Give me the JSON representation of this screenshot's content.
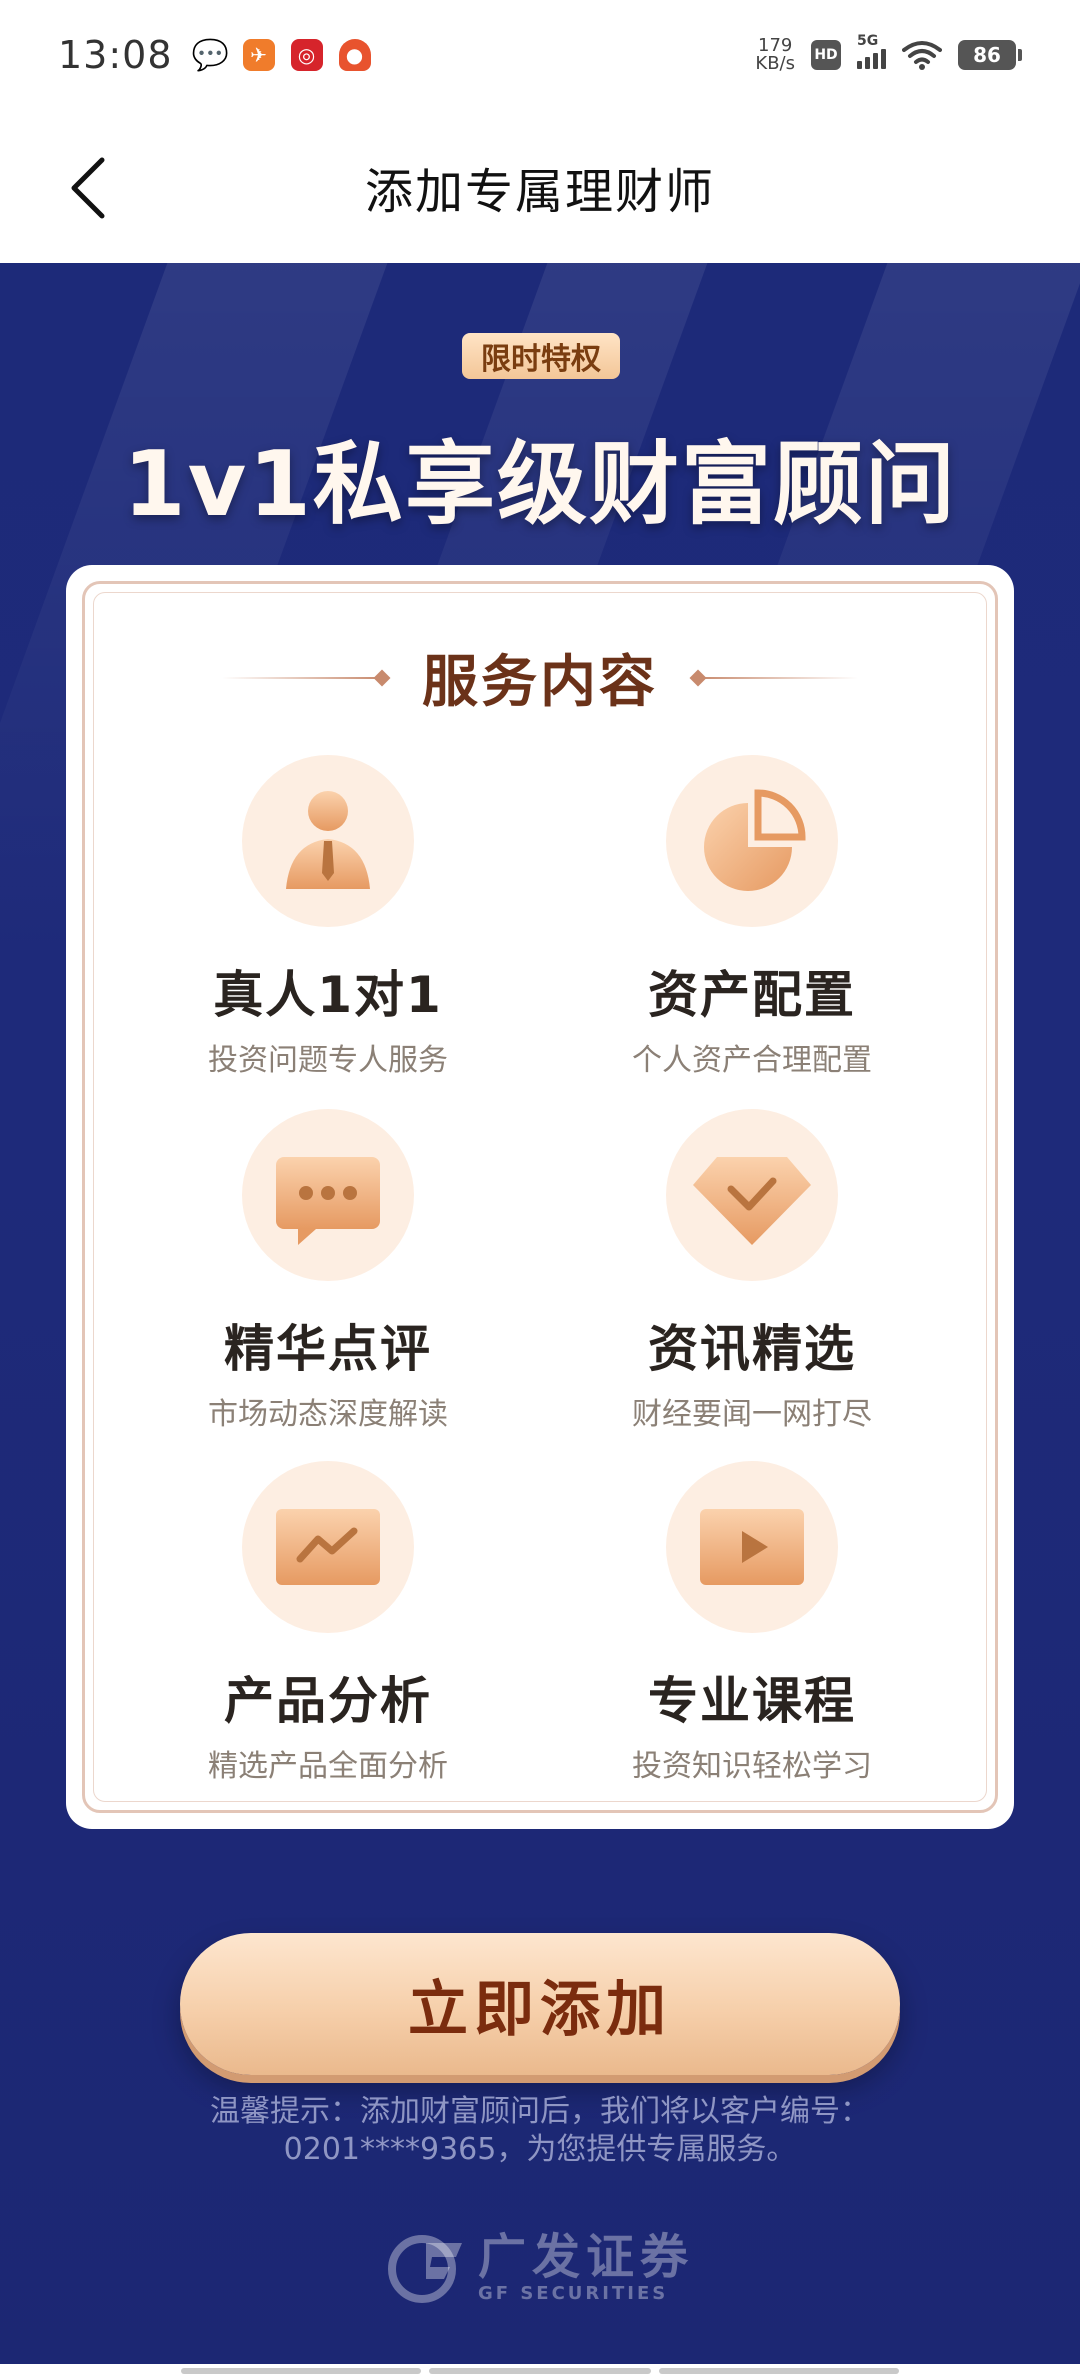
{
  "status_bar": {
    "time": "13:08",
    "speed_value": "179",
    "speed_unit": "KB/s",
    "hd": "HD",
    "network": "5G",
    "battery": "86"
  },
  "header": {
    "title": "添加专属理财师"
  },
  "hero": {
    "badge": "限时特权",
    "title": "1v1私享级财富顾问"
  },
  "card": {
    "section_title": "服务内容",
    "services": [
      {
        "name": "真人1对1",
        "desc": "投资问题专人服务",
        "icon": "advisor-person-icon"
      },
      {
        "name": "资产配置",
        "desc": "个人资产合理配置",
        "icon": "pie-chart-icon"
      },
      {
        "name": "精华点评",
        "desc": "市场动态深度解读",
        "icon": "chat-bubble-icon"
      },
      {
        "name": "资讯精选",
        "desc": "财经要闻一网打尽",
        "icon": "diamond-icon"
      },
      {
        "name": "产品分析",
        "desc": "精选产品全面分析",
        "icon": "trend-chart-icon"
      },
      {
        "name": "专业课程",
        "desc": "投资知识轻松学习",
        "icon": "video-play-icon"
      }
    ]
  },
  "cta": {
    "label": "立即添加"
  },
  "tip": {
    "line1": "温馨提示：添加财富顾问后，我们将以客户编号：",
    "line2": "0201****9365，为您提供专属服务。"
  },
  "brand": {
    "cn": "广发证券",
    "en": "GF SECURITIES"
  },
  "colors": {
    "background_blue": "#1e2a7a",
    "accent_gold": "#f3c698",
    "title_brown": "#6b3219"
  }
}
